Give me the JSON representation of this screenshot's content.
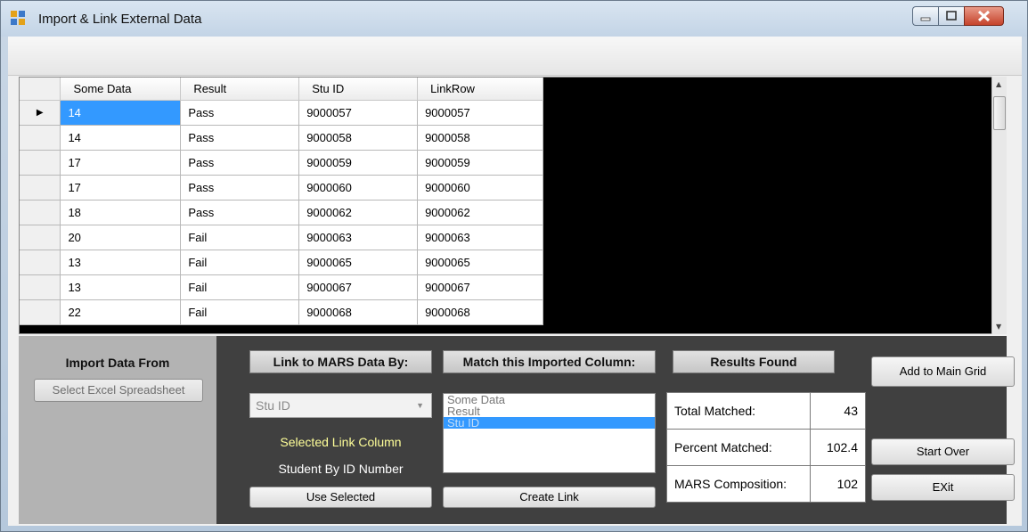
{
  "window": {
    "title": "Import & Link External Data"
  },
  "grid": {
    "columns": [
      "Some Data",
      "Result",
      "Stu ID",
      "LinkRow"
    ],
    "current_row_marker": "▶",
    "rows": [
      [
        "14",
        "Pass",
        "9000057",
        "9000057"
      ],
      [
        "14",
        "Pass",
        "9000058",
        "9000058"
      ],
      [
        "17",
        "Pass",
        "9000059",
        "9000059"
      ],
      [
        "17",
        "Pass",
        "9000060",
        "9000060"
      ],
      [
        "18",
        "Pass",
        "9000062",
        "9000062"
      ],
      [
        "20",
        "Fail",
        "9000063",
        "9000063"
      ],
      [
        "13",
        "Fail",
        "9000065",
        "9000065"
      ],
      [
        "13",
        "Fail",
        "9000067",
        "9000067"
      ],
      [
        "22",
        "Fail",
        "9000068",
        "9000068"
      ]
    ]
  },
  "import_panel": {
    "heading": "Import Data From",
    "select_excel_label": "Select Excel Spreadsheet"
  },
  "link_panel": {
    "heading": "Link to MARS Data By:",
    "combo_value": "Stu ID",
    "selected_caption": "Selected Link Column",
    "description": "Student By ID Number",
    "use_selected_label": "Use Selected"
  },
  "match_panel": {
    "heading": "Match this Imported Column:",
    "options": [
      "Some Data",
      "Result",
      "Stu ID"
    ],
    "selected_option": "Stu ID",
    "create_link_label": "Create Link"
  },
  "results_panel": {
    "heading": "Results Found",
    "rows": [
      {
        "label": "Total Matched:",
        "value": "43"
      },
      {
        "label": "Percent Matched:",
        "value": "102.4"
      },
      {
        "label": "MARS Composition:",
        "value": "102"
      }
    ]
  },
  "actions": {
    "add_to_main_grid_label": "Add to Main Grid",
    "start_over_label": "Start Over",
    "exit_label": "EXit"
  },
  "colors": {
    "selection": "#3399ff",
    "panel_dark": "#404040",
    "panel_light": "#b3b3b3",
    "accent_text": "#ffff99"
  }
}
